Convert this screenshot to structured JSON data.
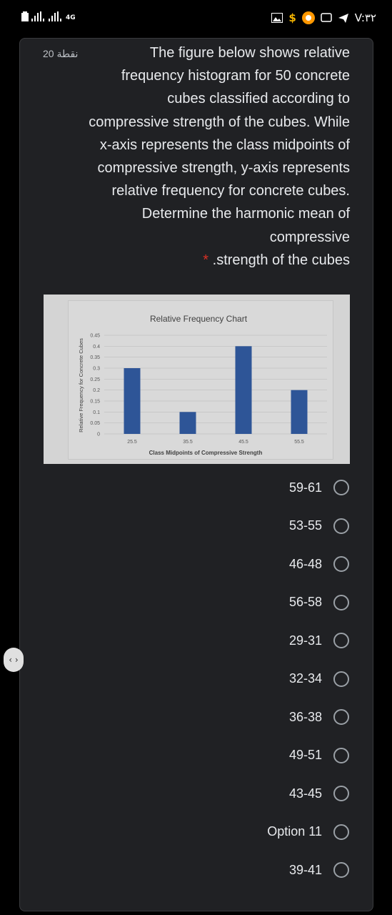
{
  "status": {
    "network": "4G",
    "time": "V:٣٢"
  },
  "form": {
    "points": "20 نقطة",
    "question": "The figure below shows relative frequency histogram for 50 concrete cubes classified according to compressive strength of the cubes. While x-axis represents the class midpoints of compressive strength, y-axis represents relative frequency for concrete cubes. Determine the harmonic mean of compressive",
    "question_tail": ".strength of the cubes",
    "required_mark": "*"
  },
  "chart_data": {
    "type": "bar",
    "title": "Relative Frequency Chart",
    "xlabel": "Class Midpoints of Compressive Strength",
    "ylabel": "Relative Frequency for Concrete Cubes",
    "categories": [
      "25.5",
      "35.5",
      "45.5",
      "55.5"
    ],
    "values": [
      0.3,
      0.1,
      0.4,
      0.2
    ],
    "yticks": [
      "0",
      "0.05",
      "0.1",
      "0.15",
      "0.2",
      "0.25",
      "0.3",
      "0.35",
      "0.4",
      "0.45"
    ],
    "ylim": [
      0,
      0.45
    ],
    "grid": true,
    "bar_color": "#2e5597"
  },
  "options": [
    "59-61",
    "53-55",
    "46-48",
    "56-58",
    "29-31",
    "32-34",
    "36-38",
    "49-51",
    "43-45",
    "Option 11",
    "39-41"
  ],
  "scroll_handle": "‹ ›"
}
